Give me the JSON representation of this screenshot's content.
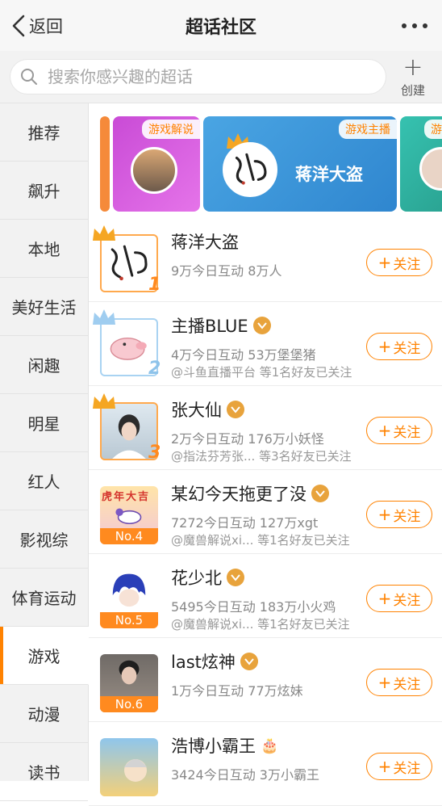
{
  "header": {
    "back_label": "返回",
    "title": "超话社区"
  },
  "search": {
    "placeholder": "搜索你感兴趣的超话",
    "create_label": "创建"
  },
  "sidebar": {
    "items": [
      {
        "label": "推荐",
        "active": false
      },
      {
        "label": "飙升",
        "active": false
      },
      {
        "label": "本地",
        "active": false
      },
      {
        "label": "美好生活",
        "active": false
      },
      {
        "label": "闲趣",
        "active": false
      },
      {
        "label": "明星",
        "active": false
      },
      {
        "label": "红人",
        "active": false
      },
      {
        "label": "影视综",
        "active": false
      },
      {
        "label": "体育运动",
        "active": false
      },
      {
        "label": "游戏",
        "active": true
      },
      {
        "label": "动漫",
        "active": false
      },
      {
        "label": "读书",
        "active": false
      }
    ]
  },
  "banner": {
    "cards": [
      {
        "tag": "游戏解说",
        "title": ""
      },
      {
        "tag": "游戏主播",
        "title": "蒋洋大盗"
      },
      {
        "tag": "游",
        "title": ""
      }
    ]
  },
  "list": {
    "follow_label": "关注",
    "rows": [
      {
        "rank": "1",
        "name": "蒋洋大盗",
        "stat": "9万今日互动 8万人",
        "sub": "",
        "verified": false
      },
      {
        "rank": "2",
        "name": "主播BLUE",
        "stat": "4万今日互动 53万堡堡猪",
        "sub": "@斗鱼直播平台 等1名好友已关注",
        "verified": true
      },
      {
        "rank": "3",
        "name": "张大仙",
        "stat": "2万今日互动 176万小妖怪",
        "sub": "@指法芬芳张... 等3名好友已关注",
        "verified": true
      },
      {
        "rank": "No.4",
        "name": "某幻今天拖更了没",
        "stat": "7272今日互动 127万xgt",
        "sub": "@魔兽解说xi...  等1名好友已关注",
        "verified": true,
        "poster": "虎年大吉"
      },
      {
        "rank": "No.5",
        "name": "花少北",
        "stat": "5495今日互动 183万小火鸡",
        "sub": "@魔兽解说xi...  等1名好友已关注",
        "verified": true
      },
      {
        "rank": "No.6",
        "name": "last炫神",
        "stat": "1万今日互动 77万炫妹",
        "sub": "",
        "verified": true
      },
      {
        "rank": "",
        "name": "浩博小霸王",
        "stat": "3424今日互动 3万小霸王",
        "sub": "",
        "verified": false
      }
    ]
  },
  "colors": {
    "accent": "#ff8200",
    "badge": "#e8a33c"
  }
}
